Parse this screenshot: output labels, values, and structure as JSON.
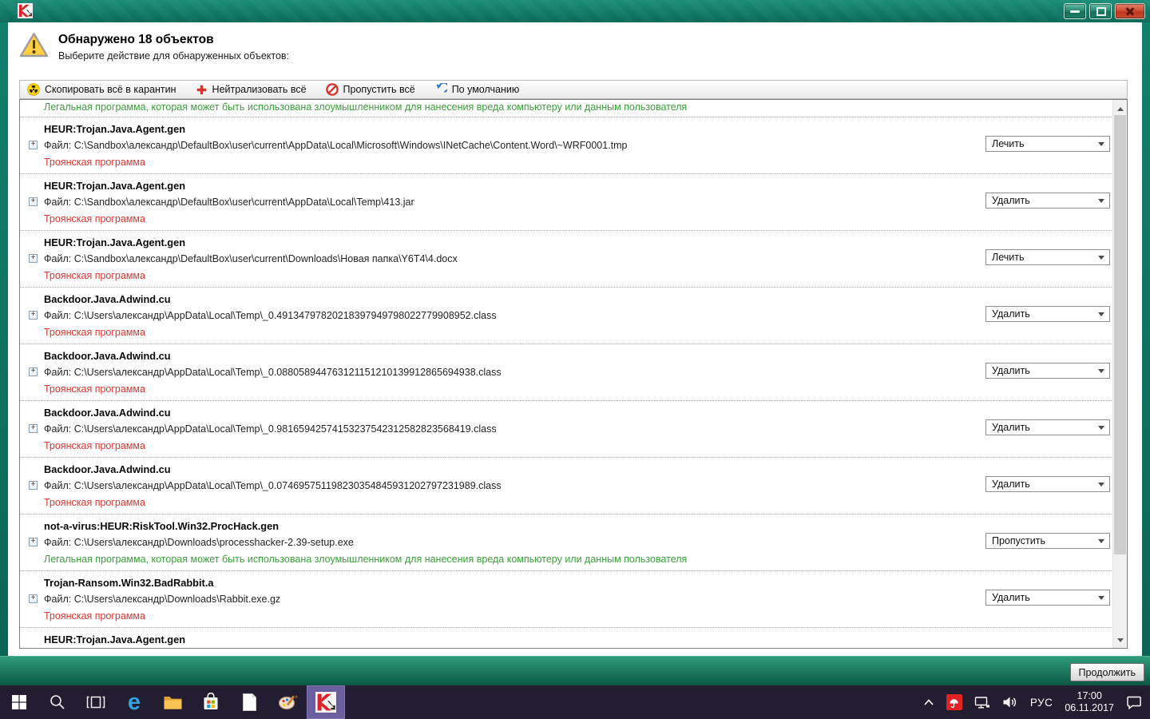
{
  "header": {
    "title": "Обнаружено 18 объектов",
    "subtitle": "Выберите действие для обнаруженных объектов:"
  },
  "toolbar": {
    "buttons": [
      {
        "id": "quarantine-all",
        "label": "Скопировать всё в карантин"
      },
      {
        "id": "neutralize-all",
        "label": "Нейтрализовать всё"
      },
      {
        "id": "skip-all",
        "label": "Пропустить всё"
      },
      {
        "id": "by-default",
        "label": "По умолчанию"
      }
    ]
  },
  "list": {
    "file_label": "Файл:",
    "expander_glyph": "+",
    "top_partial": {
      "status": "Легальная программа, которая может быть использована злоумышленником для нанесения вреда компьютеру или данным пользователя",
      "status_type": "green"
    },
    "rows": [
      {
        "name": "HEUR:Trojan.Java.Agent.gen",
        "path": "C:\\Sandbox\\александр\\DefaultBox\\user\\current\\AppData\\Local\\Microsoft\\Windows\\INetCache\\Content.Word\\~WRF0001.tmp",
        "status": "Троянская программа",
        "status_type": "red",
        "action": "Лечить"
      },
      {
        "name": "HEUR:Trojan.Java.Agent.gen",
        "path": "C:\\Sandbox\\александр\\DefaultBox\\user\\current\\AppData\\Local\\Temp\\413.jar",
        "status": "Троянская программа",
        "status_type": "red",
        "action": "Удалить"
      },
      {
        "name": "HEUR:Trojan.Java.Agent.gen",
        "path": "C:\\Sandbox\\александр\\DefaultBox\\user\\current\\Downloads\\Новая папка\\Y6T4\\4.docx",
        "status": "Троянская программа",
        "status_type": "red",
        "action": "Лечить"
      },
      {
        "name": "Backdoor.Java.Adwind.cu",
        "path": "C:\\Users\\александр\\AppData\\Local\\Temp\\_0.49134797820218397949798022779908952.class",
        "status": "Троянская программа",
        "status_type": "red",
        "action": "Удалить"
      },
      {
        "name": "Backdoor.Java.Adwind.cu",
        "path": "C:\\Users\\александр\\AppData\\Local\\Temp\\_0.088058944763121151210139912865694938.class",
        "status": "Троянская программа",
        "status_type": "red",
        "action": "Удалить"
      },
      {
        "name": "Backdoor.Java.Adwind.cu",
        "path": "C:\\Users\\александр\\AppData\\Local\\Temp\\_0.98165942574153237542312582823568419.class",
        "status": "Троянская программа",
        "status_type": "red",
        "action": "Удалить"
      },
      {
        "name": "Backdoor.Java.Adwind.cu",
        "path": "C:\\Users\\александр\\AppData\\Local\\Temp\\_0.074695751198230354845931202797231989.class",
        "status": "Троянская программа",
        "status_type": "red",
        "action": "Удалить"
      },
      {
        "name": "not-a-virus:HEUR:RiskTool.Win32.ProcHack.gen",
        "path": "C:\\Users\\александр\\Downloads\\processhacker-2.39-setup.exe",
        "status": "Легальная программа, которая может быть использована злоумышленником для нанесения вреда компьютеру или данным пользователя",
        "status_type": "green",
        "action": "Пропустить"
      },
      {
        "name": "Trojan-Ransom.Win32.BadRabbit.a",
        "path": "C:\\Users\\александр\\Downloads\\Rabbit.exe.gz",
        "status": "Троянская программа",
        "status_type": "red",
        "action": "Удалить"
      }
    ],
    "bottom_partial": {
      "name": "HEUR:Trojan.Java.Agent.gen"
    }
  },
  "footer": {
    "continue_label": "Продолжить"
  },
  "taskbar": {
    "edge_glyph": "e",
    "language": "РУС",
    "time": "17:00",
    "date": "06.11.2017"
  }
}
